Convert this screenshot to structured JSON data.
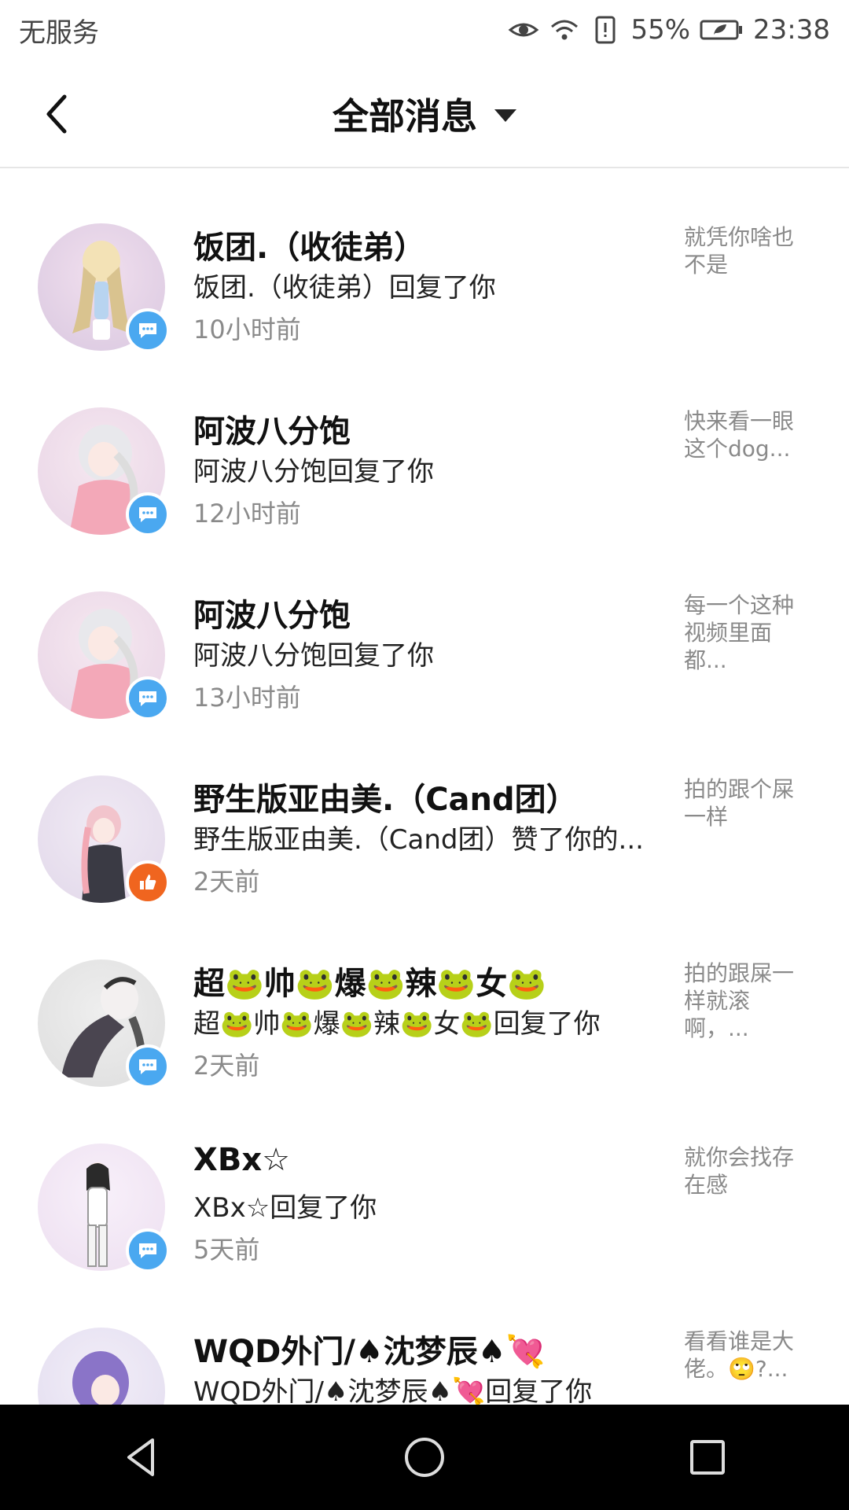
{
  "status_bar": {
    "carrier": "无服务",
    "battery": "55%",
    "time": "23:38"
  },
  "header": {
    "title": "全部消息"
  },
  "messages": [
    {
      "name": "饭团.（收徒弟）",
      "action": "饭团.（收徒弟）回复了你",
      "time": "10小时前",
      "preview": "就凭你啥也不是",
      "type": "comment"
    },
    {
      "name": "阿波八分饱",
      "action": "阿波八分饱回复了你",
      "time": "12小时前",
      "preview": "快来看一眼这个dog...",
      "type": "comment"
    },
    {
      "name": "阿波八分饱",
      "action": "阿波八分饱回复了你",
      "time": "13小时前",
      "preview": "每一个这种视频里面都...",
      "type": "comment"
    },
    {
      "name": "野生版亚由美.（Cand团）",
      "action": "野生版亚由美.（Cand团）赞了你的...",
      "time": "2天前",
      "preview": "拍的跟个屎一样",
      "type": "like"
    },
    {
      "name": "超🐸帅🐸爆🐸辣🐸女🐸",
      "action": "超🐸帅🐸爆🐸辣🐸女🐸回复了你",
      "time": "2天前",
      "preview": "拍的跟屎一样就滚啊，...",
      "type": "comment"
    },
    {
      "name": "XBx☆",
      "action": "XBx☆回复了你",
      "time": "5天前",
      "preview": "就你会找存在感",
      "type": "comment"
    },
    {
      "name": "WQD外门/♠沈梦辰♠💘",
      "action": "WQD外门/♠沈梦辰♠💘回复了你",
      "time": "",
      "preview": "看看谁是大佬。🙄?...",
      "type": "comment"
    }
  ]
}
